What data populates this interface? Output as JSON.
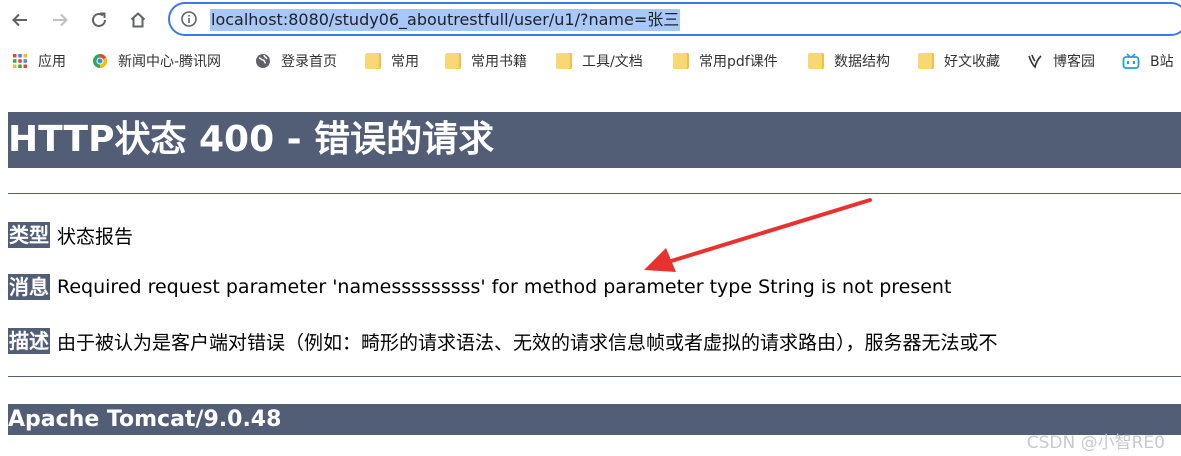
{
  "browser": {
    "url": "localhost:8080/study06_aboutrestfull/user/u1/?name=张三"
  },
  "bookmarks": [
    {
      "label": "应用",
      "icon": "apps-grid-icon"
    },
    {
      "label": "新闻中心-腾讯网",
      "icon": "tencent-news-icon"
    },
    {
      "label": "登录首页",
      "icon": "globe-icon"
    },
    {
      "label": "常用",
      "icon": "folder-icon"
    },
    {
      "label": "常用书籍",
      "icon": "folder-icon"
    },
    {
      "label": "工具/文档",
      "icon": "folder-icon"
    },
    {
      "label": "常用pdf课件",
      "icon": "folder-icon"
    },
    {
      "label": "数据结构",
      "icon": "folder-icon"
    },
    {
      "label": "好文收藏",
      "icon": "folder-icon"
    },
    {
      "label": "博客园",
      "icon": "cnblogs-icon"
    },
    {
      "label": "B站",
      "icon": "bilibili-icon"
    }
  ],
  "page": {
    "title": "HTTP状态 400 - 错误的请求",
    "type_label": "类型",
    "type_value": "状态报告",
    "message_label": "消息",
    "message_value": "Required request parameter 'namesssssssss' for method parameter type String is not present",
    "description_label": "描述",
    "description_value": "由于被认为是客户端对错误（例如：畸形的请求语法、无效的请求信息帧或者虚拟的请求路由），服务器无法或不",
    "footer": "Apache Tomcat/9.0.48"
  },
  "watermark": "CSDN @小智RE0",
  "colors": {
    "tomcat_header": "#525d76",
    "annotation_arrow": "#e8322f",
    "url_highlight": "#a8c7fa"
  }
}
